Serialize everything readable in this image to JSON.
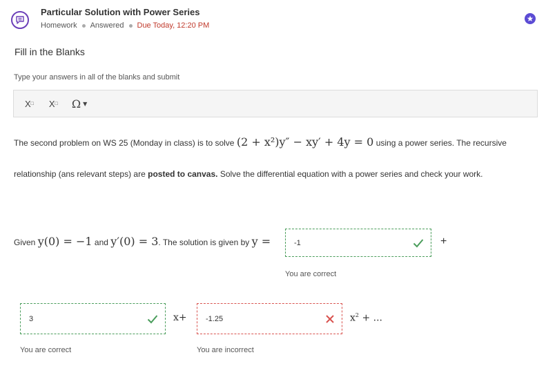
{
  "header": {
    "title": "Particular Solution with Power Series",
    "type": "Homework",
    "status": "Answered",
    "due": "Due Today, 12:20 PM"
  },
  "section_title": "Fill in the Blanks",
  "instructions": "Type your answers in all of the blanks and submit",
  "toolbar": {
    "subscript_label": "X",
    "superscript_label": "X",
    "symbols_label": "Ω"
  },
  "problem": {
    "line1_prefix": "The second problem on WS 25 (Monday in class) is to solve",
    "equation": "(2 + x²)y″ − xy′ + 4y = 0",
    "line1_suffix": "using a power series. The recursive",
    "line2_prefix": "relationship (ans relevant steps) are",
    "line2_bold": "posted to canvas.",
    "line2_suffix": "Solve the differential equation with a power series and check your work."
  },
  "given": {
    "prefix": "Given",
    "cond1": "y(0) = −1",
    "and": "and",
    "cond2": "y′(0) = 3",
    "text": ". The solution is given by",
    "lhs": "y ="
  },
  "answers": [
    {
      "value": "-1",
      "feedback": "You are correct",
      "correct": true
    },
    {
      "value": "3",
      "feedback": "You are correct",
      "correct": true
    },
    {
      "value": "-1.25",
      "feedback": "You are incorrect",
      "correct": false
    }
  ],
  "terms": {
    "plus1": "+",
    "x_plus": "x+",
    "x2_base": "x",
    "x2_exp": "2",
    "tail": "+ ..."
  },
  "colors": {
    "accent": "#5b4bd4",
    "correct": "#4a9d5b",
    "incorrect": "#d9534f",
    "due": "#c0392b"
  }
}
